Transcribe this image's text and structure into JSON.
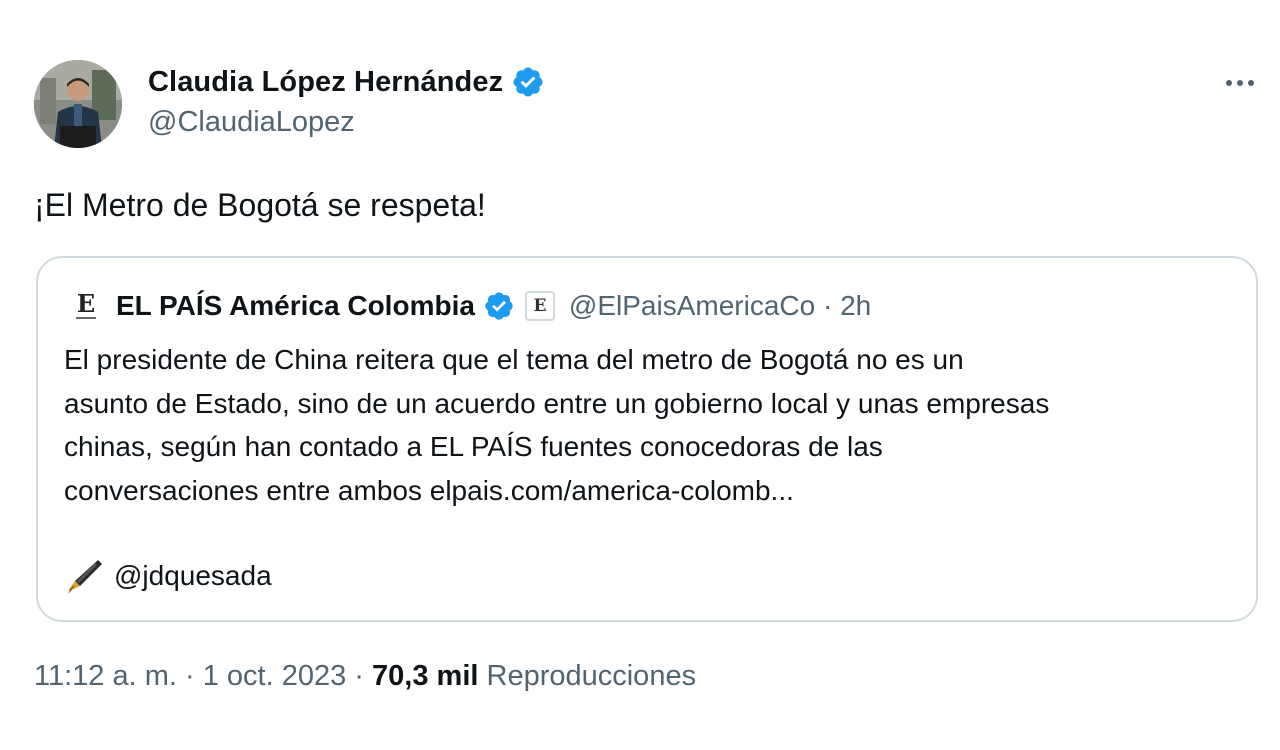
{
  "author": {
    "name": "Claudia López Hernández",
    "handle": "@ClaudiaLopez",
    "verified": true
  },
  "tweet": {
    "text": "¡El Metro de Bogotá se respeta!"
  },
  "quoted_tweet": {
    "name": "EL PAÍS América Colombia",
    "handle": "@ElPaisAmericaCo",
    "separator": "·",
    "time": "2h",
    "verified": true,
    "affiliate_badge_letter": "E",
    "logo_letter": "E",
    "body_lines": [
      "El presidente de China reitera que el tema del metro de Bogotá no es un",
      "asunto de Estado, sino de un acuerdo entre un gobierno local y unas empresas",
      "chinas, según han contado a EL PAÍS fuentes conocedoras de las",
      "conversaciones entre ambos elpais.com/america-colomb..."
    ],
    "credit_handle": "@jdquesada",
    "credit_icon": "fountain-pen-icon"
  },
  "footer": {
    "time": "11:12 a. m.",
    "dot1": "·",
    "date": "1 oct. 2023",
    "dot2": "·",
    "views_count": "70,3 mil",
    "views_label": "Reproducciones"
  },
  "colors": {
    "verified_blue": "#1d9bf0",
    "secondary_text": "#536471",
    "border": "#cfd9de",
    "primary_text": "#0f1419"
  }
}
